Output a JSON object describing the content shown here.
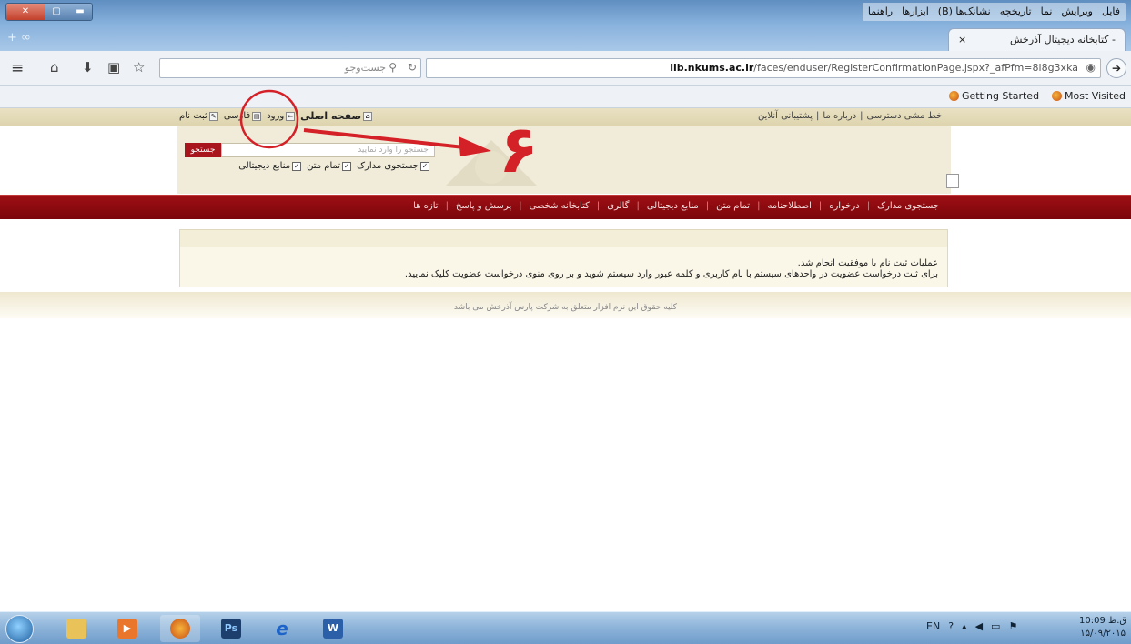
{
  "window": {
    "menu": [
      "فایل",
      "ویرایش",
      "نما",
      "تاریخچه",
      "نشانک‌ها (B)",
      "ابزارها",
      "راهنما"
    ],
    "tab_title": "- کتابخانه دیجیتال آذرخش",
    "tab_close": "×",
    "new_tab": "+ ∞"
  },
  "navbar": {
    "search_placeholder": "جست‌وجو",
    "url_host": "lib.nkums.ac.ir",
    "url_path": "/faces/enduser/RegisterConfirmationPage.jspx?_afPfm=8i8g3xka",
    "go": "➔"
  },
  "bookmarks": {
    "items": [
      "Most Visited",
      "Getting Started"
    ]
  },
  "site": {
    "top_links_right": [
      "خط مشی دسترسی",
      "درباره ما",
      "پشتیبانی آنلاین"
    ],
    "top_links_left": {
      "home": "صفحه اصلی",
      "login": "ورود",
      "language": "فارسی",
      "register": "ثبت نام"
    },
    "search": {
      "button": "جستجو",
      "placeholder": "جستجو را وارد نمایید",
      "checks": [
        "جستجوی مدارک",
        "تمام متن",
        "منابع دیجیتالی"
      ]
    },
    "menu": [
      "جستجوی مدارک",
      "درخواره",
      "اصطلاحنامه",
      "تمام متن",
      "منابع دیجیتالی",
      "گالری",
      "کتابخانه شخصی",
      "پرسش و پاسخ",
      "تازه ها"
    ],
    "message_line1": "عملیات ثبت نام با موفقیت انجام شد.",
    "message_line2": "برای ثبت درخواست عضویت در واحدهای سیستم با نام کاربری و کلمه عبور وارد سیستم شوید و بر روی منوی درخواست عضویت کلیک نمایید.",
    "footer": "کلیه حقوق این نرم افزار متعلق به شرکت پارس آذرخش می باشد"
  },
  "annotation": {
    "number": "۶",
    "color": "#d42027"
  },
  "taskbar": {
    "apps": [
      "explorer",
      "media",
      "firefox",
      "Ps",
      "ie",
      "word"
    ],
    "tray_lang": "EN",
    "time": "10:09 ق.ظ",
    "date": "۱۵/۰۹/۲۰۱۵"
  }
}
